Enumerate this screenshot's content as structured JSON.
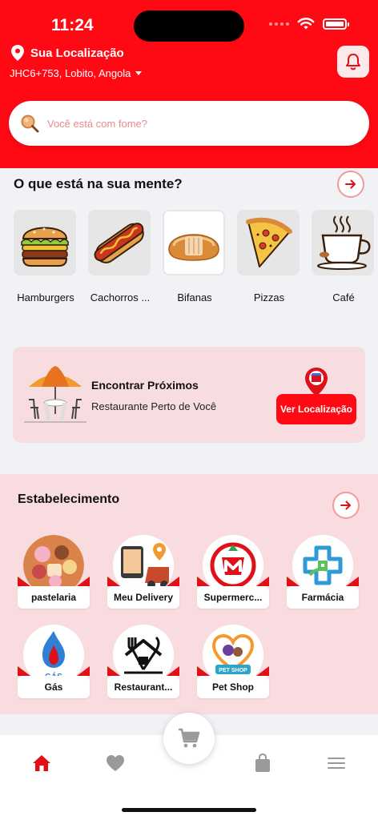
{
  "status_bar": {
    "time": "11:24"
  },
  "header": {
    "location_title": "Sua Localização",
    "location_address": "JHC6+753, Lobito, Angola"
  },
  "search": {
    "placeholder": "Você está com fome?"
  },
  "categories_section": {
    "title": "O que está na sua mente?",
    "items": [
      {
        "label": "Hamburgers",
        "icon": "burger-icon"
      },
      {
        "label": "Cachorros ...",
        "icon": "hotdog-icon"
      },
      {
        "label": "Bifanas",
        "icon": "bifana-icon"
      },
      {
        "label": "Pizzas",
        "icon": "pizza-icon"
      },
      {
        "label": "Café",
        "icon": "coffee-icon"
      }
    ]
  },
  "promo": {
    "title": "Encontrar Próximos",
    "subtitle": "Restaurante Perto de Você",
    "button_label": "Ver Localização"
  },
  "establishments": {
    "title": "Estabelecimento",
    "items": [
      {
        "label": "pastelaria",
        "icon": "pastry-icon"
      },
      {
        "label": "Meu Delivery",
        "icon": "delivery-icon"
      },
      {
        "label": "Supermerc...",
        "icon": "supermarket-icon"
      },
      {
        "label": "Farmácia",
        "icon": "pharmacy-icon"
      },
      {
        "label": "Gás",
        "icon": "gas-icon",
        "logo_text": "GÁS"
      },
      {
        "label": "Restaurant...",
        "icon": "restaurant-icon"
      },
      {
        "label": "Pet Shop",
        "icon": "pet-shop-icon",
        "logo_text": "PET SHOP"
      }
    ]
  },
  "tabbar": {
    "items": [
      {
        "name": "home-icon",
        "active": true
      },
      {
        "name": "heart-icon",
        "active": false
      },
      {
        "name": "cart-icon",
        "active": false
      },
      {
        "name": "bag-icon",
        "active": false
      },
      {
        "name": "menu-icon",
        "active": false
      }
    ]
  },
  "colors": {
    "brand": "#ff0a14",
    "promo_bg": "#f8dde0",
    "active_tab": "#e01018",
    "inactive_tab": "#9a9a9a"
  }
}
